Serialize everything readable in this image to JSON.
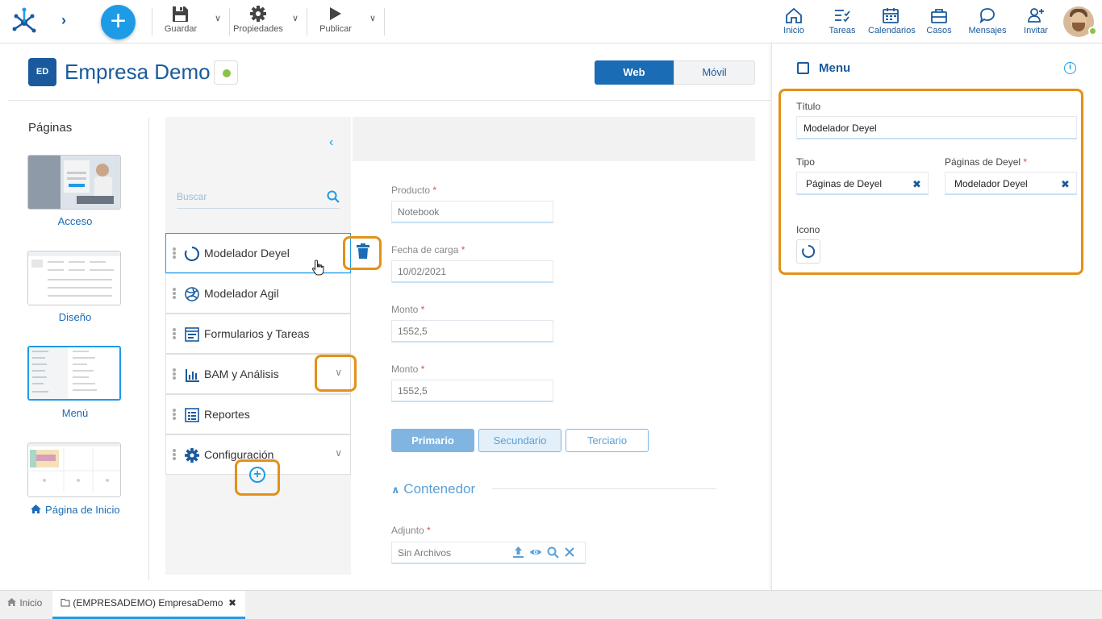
{
  "toolbar": {
    "save_label": "Guardar",
    "properties_label": "Propiedades",
    "publish_label": "Publicar"
  },
  "nav": [
    {
      "label": "Inicio",
      "icon": "home-icon"
    },
    {
      "label": "Tareas",
      "icon": "tasks-icon"
    },
    {
      "label": "Calendarios",
      "icon": "calendar-icon"
    },
    {
      "label": "Casos",
      "icon": "briefcase-icon"
    },
    {
      "label": "Mensajes",
      "icon": "chat-icon"
    },
    {
      "label": "Invitar",
      "icon": "invite-user-icon"
    }
  ],
  "header": {
    "badge": "ED",
    "title": "Empresa Demo",
    "status_color": "#8bc34a",
    "mode_web": "Web",
    "mode_mobile": "Móvil"
  },
  "pages": {
    "title": "Páginas",
    "items": [
      {
        "label": "Acceso"
      },
      {
        "label": "Diseño"
      },
      {
        "label": "Menú",
        "selected": true
      },
      {
        "label": "Página de Inicio",
        "icon": "home-icon"
      }
    ]
  },
  "menu": {
    "search_placeholder": "Buscar",
    "items": [
      {
        "label": "Modelador Deyel",
        "icon": "spinner-icon",
        "selected": true
      },
      {
        "label": "Modelador Agil",
        "icon": "agile-icon"
      },
      {
        "label": "Formularios y Tareas",
        "icon": "form-icon"
      },
      {
        "label": "BAM y Análisis",
        "icon": "chart-icon",
        "expandable": true
      },
      {
        "label": "Reportes",
        "icon": "report-icon"
      },
      {
        "label": "Configuración",
        "icon": "gear-icon",
        "expandable": true
      }
    ]
  },
  "form": {
    "fields": [
      {
        "label": "Producto",
        "required": "*",
        "value": "Notebook"
      },
      {
        "label": "Fecha de carga",
        "required": "*",
        "value": "10/02/2021"
      },
      {
        "label": "Monto",
        "required": "*",
        "value": "1552,5"
      },
      {
        "label": "Monto",
        "required": "*",
        "value": "1552,5"
      }
    ],
    "buttons": {
      "primary": "Primario",
      "secondary": "Secundario",
      "tertiary": "Terciario"
    },
    "container_title": "Contenedor",
    "attachment": {
      "label": "Adjunto",
      "required": "*",
      "value": "Sin Archivos"
    }
  },
  "properties": {
    "title": "Menu",
    "titulo_label": "Título",
    "titulo_value": "Modelador Deyel",
    "tipo_label": "Tipo",
    "tipo_value": "Páginas de Deyel",
    "paginas_label": "Páginas de Deyel",
    "paginas_required": "*",
    "paginas_value": "Modelador Deyel",
    "icono_label": "Icono"
  },
  "bottom_tabs": {
    "home": "Inicio",
    "doc": "(EMPRESADEMO) EmpresaDemo"
  },
  "colors": {
    "brand": "#1a5a9c",
    "accent": "#1e9be6",
    "highlight": "#e39117"
  }
}
